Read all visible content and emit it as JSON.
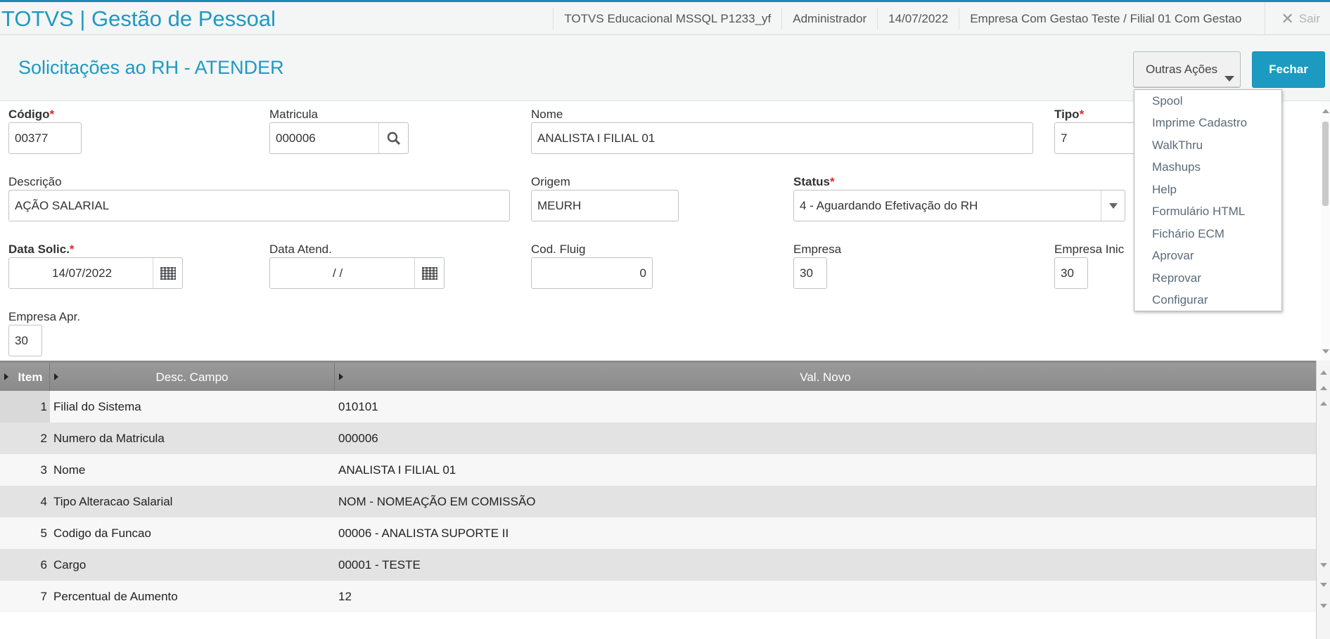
{
  "topbar": {
    "app_title": "TOTVS | Gestão de Pessoal",
    "environment": "TOTVS Educacional MSSQL P1233_yf",
    "user": "Administrador",
    "date": "14/07/2022",
    "company": "Empresa Com Gestao Teste / Filial 01 Com Gestao",
    "logout_label": "Sair"
  },
  "header": {
    "title": "Solicitações ao RH - ATENDER",
    "other_actions_label": "Outras Ações",
    "close_label": "Fechar"
  },
  "menu": {
    "items": [
      "Spool",
      "Imprime Cadastro",
      "WalkThru",
      "Mashups",
      "Help",
      "Formulário HTML",
      "Fichário ECM",
      "Aprovar",
      "Reprovar",
      "Configurar"
    ]
  },
  "form": {
    "codigo": {
      "label": "Código",
      "value": "00377"
    },
    "matricula": {
      "label": "Matricula",
      "value": "000006"
    },
    "nome": {
      "label": "Nome",
      "value": "ANALISTA I FILIAL 01"
    },
    "tipo": {
      "label": "Tipo",
      "value": "7"
    },
    "descricao": {
      "label": "Descrição",
      "value": "AÇÃO SALARIAL"
    },
    "origem": {
      "label": "Origem",
      "value": "MEURH"
    },
    "status": {
      "label": "Status",
      "value": "4 - Aguardando Efetivação do RH"
    },
    "data_solic": {
      "label": "Data Solic.",
      "value": "14/07/2022"
    },
    "data_atend": {
      "label": "Data Atend.",
      "value": "/  /"
    },
    "cod_fluig": {
      "label": "Cod. Fluig",
      "value": "0"
    },
    "empresa": {
      "label": "Empresa",
      "value": "30"
    },
    "empresa_inic": {
      "label": "Empresa Inic",
      "value": "30"
    },
    "empresa_apr": {
      "label": "Empresa Apr.",
      "value": "30"
    },
    "required_mark": "*"
  },
  "grid": {
    "headers": {
      "item": "Item",
      "desc": "Desc. Campo",
      "val": "Val. Novo"
    },
    "rows": [
      {
        "num": "1",
        "desc": "Filial do Sistema",
        "val": "010101"
      },
      {
        "num": "2",
        "desc": "Numero da Matricula",
        "val": "000006"
      },
      {
        "num": "3",
        "desc": "Nome",
        "val": "ANALISTA I FILIAL 01"
      },
      {
        "num": "4",
        "desc": "Tipo Alteracao Salarial",
        "val": "NOM - NOMEAÇÃO EM COMISSÃO"
      },
      {
        "num": "5",
        "desc": "Codigo da Funcao",
        "val": "00006 - ANALISTA SUPORTE II"
      },
      {
        "num": "6",
        "desc": "Cargo",
        "val": "00001 - TESTE"
      },
      {
        "num": "7",
        "desc": "Percentual de Aumento",
        "val": "12"
      }
    ]
  }
}
